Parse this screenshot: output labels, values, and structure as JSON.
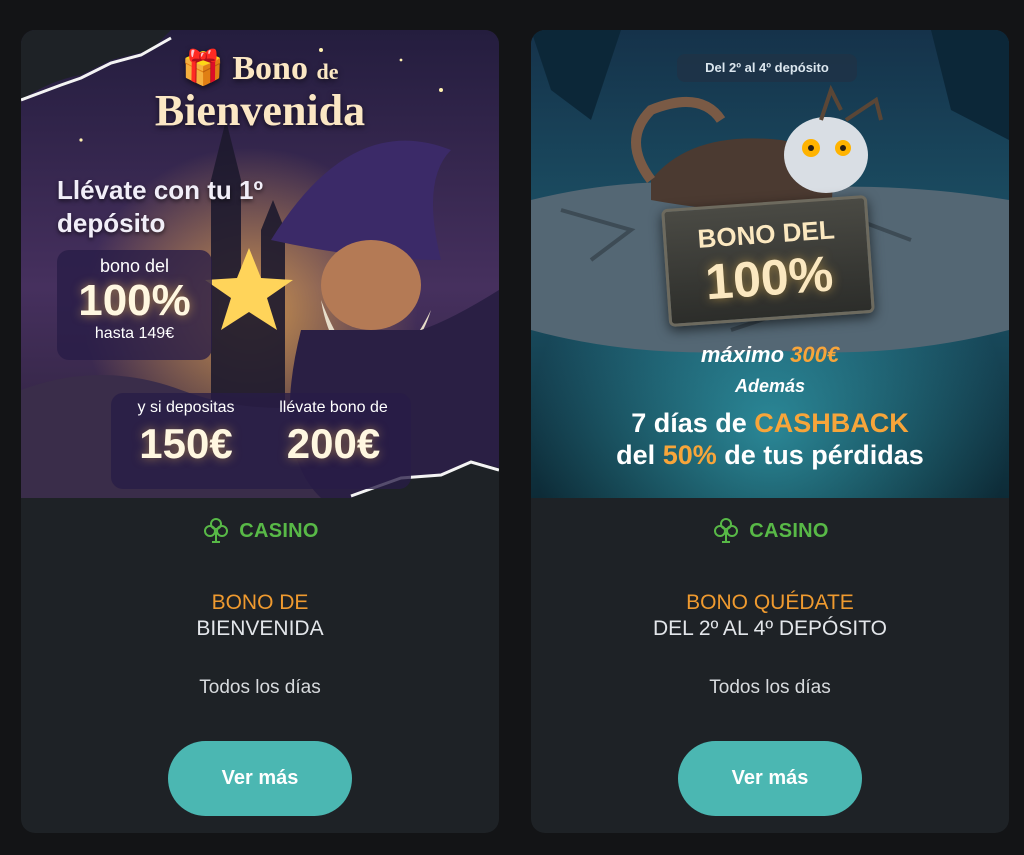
{
  "colors": {
    "page_bg": "#131416",
    "card_bg": "#1e2226",
    "category_green": "#58b947",
    "title_orange": "#ef9a2f",
    "button_teal": "#4bb7b2"
  },
  "cards": [
    {
      "banner": {
        "title_small": "Bono",
        "title_de": "de",
        "title_big": "Bienvenida",
        "lead": "Llévate con tu 1º depósito",
        "box1_line1": "bono del",
        "box1_amount": "100%",
        "box1_line3": "hasta 149€",
        "box2_left_label": "y si depositas",
        "box2_left_amount": "150€",
        "box2_right_label": "llévate bono de",
        "box2_right_amount": "200€"
      },
      "category": {
        "icon": "clover-cards-icon",
        "label": "CASINO"
      },
      "title_line1": "BONO DE",
      "title_line2": "BIENVENIDA",
      "schedule": "Todos los días",
      "button_label": "Ver más"
    },
    {
      "banner": {
        "pill": "Del 2º al 4º depósito",
        "plaque_line1": "BONO DEL",
        "plaque_line2": "100%",
        "max_prefix": "máximo",
        "max_amount": "300€",
        "ademas": "Además",
        "cash_pre": "7 días de",
        "cash_word": "CASHBACK",
        "cash_del": "del",
        "cash_pct": "50%",
        "cash_post": "de tus pérdidas"
      },
      "category": {
        "icon": "clover-cards-icon",
        "label": "CASINO"
      },
      "title_line1": "BONO QUÉDATE",
      "title_line2": "DEL 2º AL 4º DEPÓSITO",
      "schedule": "Todos los días",
      "button_label": "Ver más"
    }
  ]
}
